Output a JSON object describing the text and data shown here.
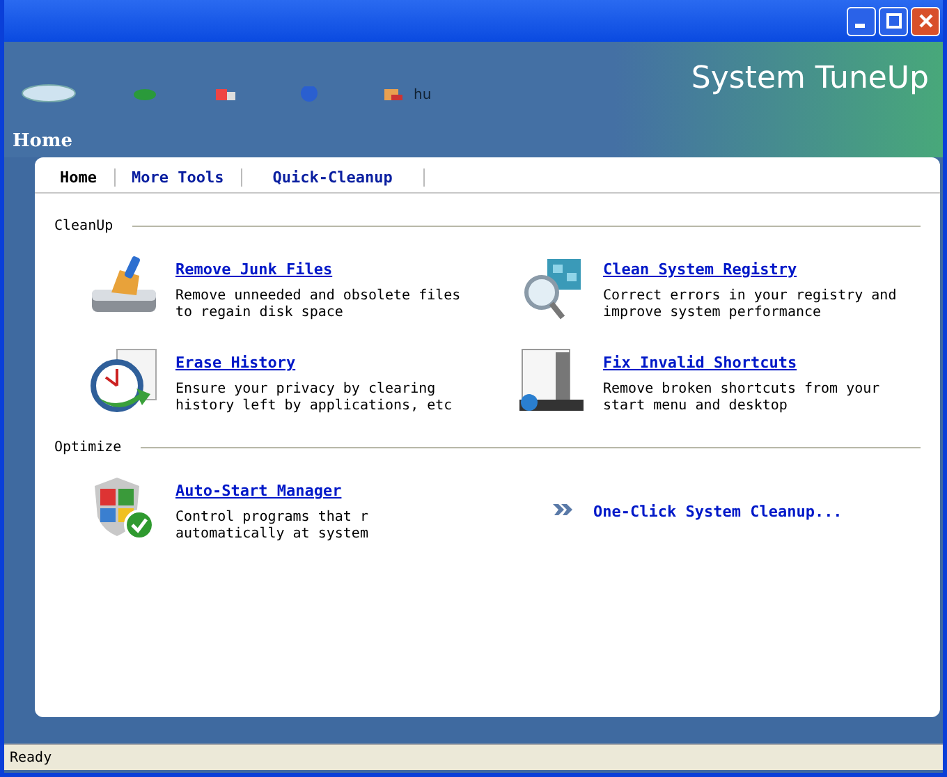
{
  "window": {
    "brand": "System TuneUp",
    "toolbar_fragment": "hu"
  },
  "breadcrumb": "Home",
  "tabs": [
    {
      "label": "Home",
      "selected": true
    },
    {
      "label": "More Tools",
      "selected": false
    },
    {
      "label": "Quick-Cleanup",
      "selected": false
    }
  ],
  "sections": [
    {
      "title": "CleanUp",
      "items": [
        {
          "kind": "broom",
          "title": "Remove Junk Files",
          "desc": "Remove unneeded and obsolete files to regain disk space"
        },
        {
          "kind": "registry",
          "title": "Clean System Registry",
          "desc": "Correct errors in your registry and improve system performance"
        },
        {
          "kind": "clock",
          "title": "Erase History",
          "desc": "Ensure your privacy by clearing history left by applications, etc"
        },
        {
          "kind": "shortcuts",
          "title": "Fix Invalid Shortcuts",
          "desc": "Remove broken shortcuts from your start menu and desktop"
        }
      ]
    },
    {
      "title": "Optimize",
      "items": [
        {
          "kind": "shield",
          "title": "Auto-Start Manager",
          "desc": "Control programs that r\nautomatically at system"
        },
        {
          "kind": "chevrons",
          "title": "One-Click System Cleanup..."
        }
      ]
    }
  ],
  "status_bar": "Ready"
}
